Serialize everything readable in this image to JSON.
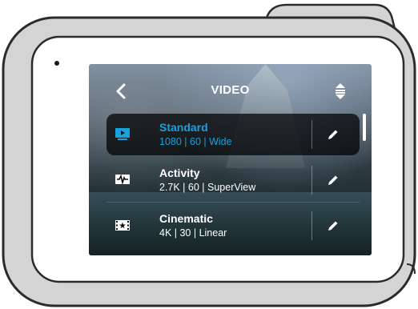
{
  "screen": {
    "title": "VIDEO",
    "icons": {
      "back": "chevron-left-icon",
      "sort": "sort-arrows-icon",
      "edit": "pencil-icon"
    },
    "accent_color": "#19a0dd"
  },
  "presets": [
    {
      "name": "Standard",
      "settings": "1080 | 60 | Wide",
      "icon": "video-play-icon",
      "selected": true
    },
    {
      "name": "Activity",
      "settings": "2.7K | 60 | SuperView",
      "icon": "waveform-icon",
      "selected": false
    },
    {
      "name": "Cinematic",
      "settings": "4K | 30 | Linear",
      "icon": "film-star-icon",
      "selected": false
    }
  ]
}
